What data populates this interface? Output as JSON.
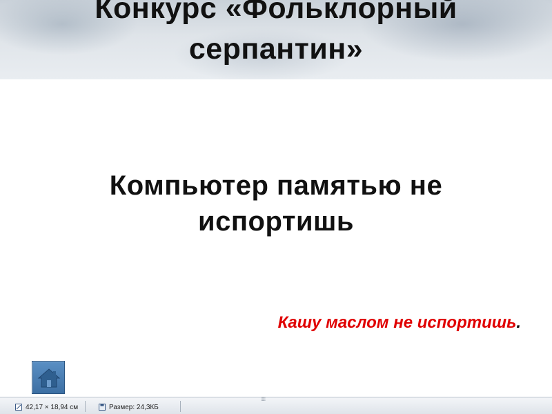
{
  "slide": {
    "title": "Конкурс «Фольклорный серпантин»",
    "question": "Компьютер памятью не испортишь",
    "answer": "Кашу маслом не испортишь",
    "answer_period": "."
  },
  "home_button": {
    "icon": "home-icon",
    "color": "#4a7fb5"
  },
  "statusbar": {
    "dimensions_text": "42,17 × 18,94 см",
    "dimensions_icon": "dimensions-icon",
    "size_text": "Размер: 24,3КБ",
    "size_icon": "disk-icon",
    "grip_icon": "resize-grip-icon"
  },
  "colors": {
    "answer_red": "#e00000",
    "title_band": "#dfe4e9",
    "text": "#111111"
  }
}
